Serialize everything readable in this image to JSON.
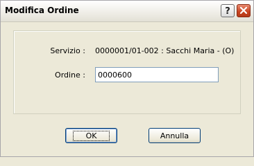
{
  "window": {
    "title": "Modifica Ordine",
    "help_icon": "help-icon",
    "close_icon": "close-icon"
  },
  "form": {
    "servizio_label": "Servizio :",
    "servizio_value": "0000001/01-002 : Sacchi Maria - (O)",
    "ordine_label": "Ordine :",
    "ordine_value": "0000600"
  },
  "buttons": {
    "ok_label": "OK",
    "cancel_label": "Annulla"
  },
  "colors": {
    "dialog_bg": "#ece9d8",
    "close_red": "#c8431f",
    "input_border": "#7f9db9",
    "button_border": "#003c74"
  }
}
